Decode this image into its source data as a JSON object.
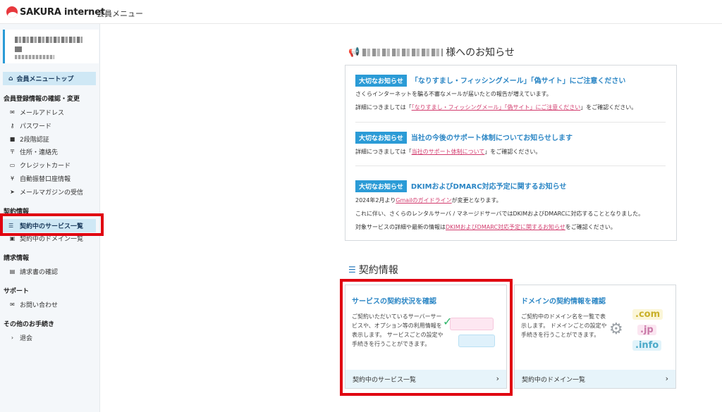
{
  "header": {
    "brand": "SAKURA internet",
    "menu_title": "会員メニュー"
  },
  "sidebar": {
    "top_item": "会員メニュートップ",
    "sections": [
      {
        "title": "会員登録情報の確認・変更",
        "items": [
          "メールアドレス",
          "パスワード",
          "2段階認証",
          "住所・連絡先",
          "クレジットカード",
          "自動振替口座情報",
          "メールマガジンの受信"
        ]
      },
      {
        "title": "契約情報",
        "items": [
          "契約中のサービス一覧",
          "契約中のドメイン一覧"
        ]
      },
      {
        "title": "請求情報",
        "items": [
          "請求書の確認"
        ]
      },
      {
        "title": "サポート",
        "items": [
          "お問い合わせ"
        ]
      },
      {
        "title": "その他のお手続き",
        "items": [
          "退会"
        ]
      }
    ]
  },
  "notices": {
    "title_suffix": "様へのお知らせ",
    "badge": "大切なお知らせ",
    "items": [
      {
        "head": "「なりすまし・フィッシングメール」「偽サイト」にご注意ください",
        "line1": "さくらインターネットを騙る不審なメールが届いたとの報告が増えています。",
        "line2_pre": "詳細につきましては「",
        "line2_link": "「なりすまし・フィッシングメール」「偽サイト」にご注意ください",
        "line2_post": "」をご確認ください。"
      },
      {
        "head": "当社の今後のサポート体制についてお知らせします",
        "line1_pre": "詳細につきましては「",
        "line1_link": "当社のサポート体制について",
        "line1_post": "」をご確認ください。"
      },
      {
        "head": "DKIMおよびDMARC対応予定に関するお知らせ",
        "line1_pre": "2024年2月より",
        "line1_link": "Gmailのガイドライン",
        "line1_post": "が変更となります。",
        "line2": "これに伴い、さくらのレンタルサーバ / マネージドサーバではDKIMおよびDMARCに対応することとなりました。",
        "line3_pre": "対象サービスの詳細や最新の情報は",
        "line3_link": "DKIMおよびDMARC対応予定に関するお知らせ",
        "line3_post": "をご確認ください。"
      }
    ]
  },
  "contract": {
    "title": "契約情報",
    "cards": [
      {
        "title": "サービスの契約状況を確認",
        "desc": "ご契約いただいているサーバーサービスや、オプション等の利用情報を表示します。 サービスごとの設定や手続きを行うことができます。",
        "footer": "契約中のサービス一覧"
      },
      {
        "title": "ドメインの契約情報を確認",
        "desc": "ご契約中のドメイン名を一覧で表示します。 ドメインごとの設定や手続きを行うことができます。",
        "footer": "契約中のドメイン一覧",
        "tlds": [
          ".com",
          ".jp",
          ".info"
        ]
      }
    ]
  },
  "colors": {
    "accent": "#2b9bd6",
    "link": "#d23c6e",
    "highlight": "#e00010"
  }
}
